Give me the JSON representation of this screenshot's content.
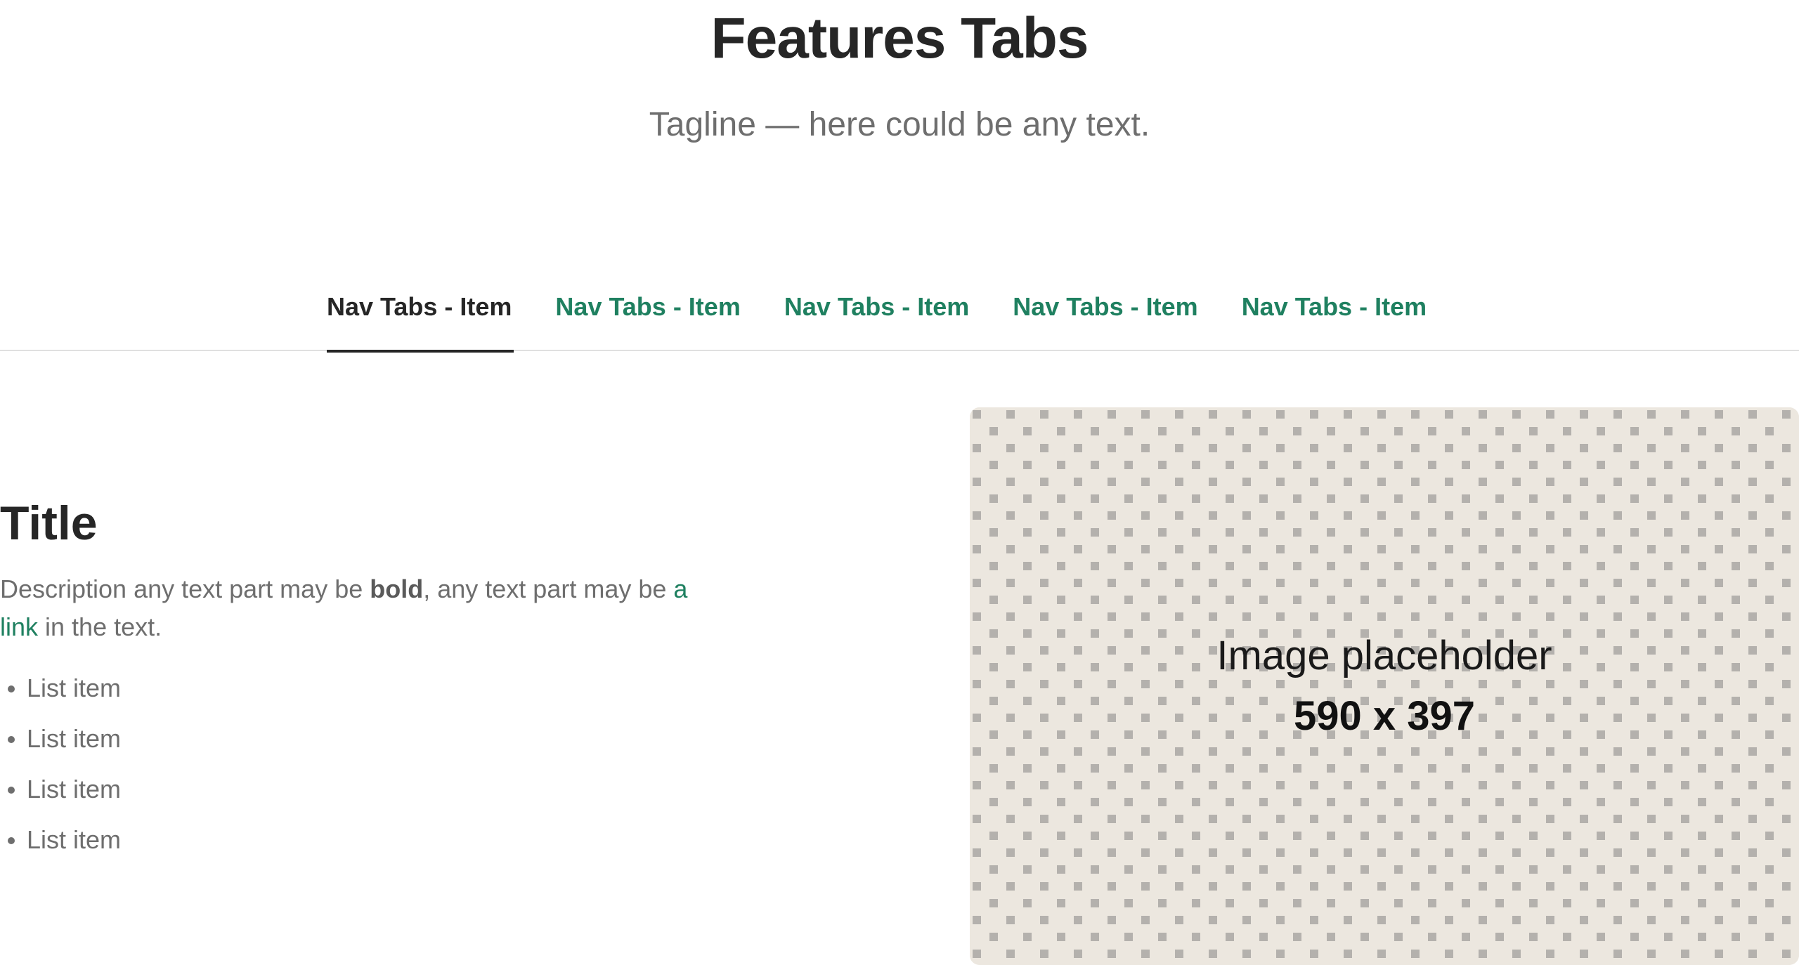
{
  "header": {
    "title": "Features Tabs",
    "tagline": "Tagline — here could be any text."
  },
  "tabs": [
    {
      "label": "Nav Tabs - Item",
      "active": true
    },
    {
      "label": "Nav Tabs - Item",
      "active": false
    },
    {
      "label": "Nav Tabs - Item",
      "active": false
    },
    {
      "label": "Nav Tabs - Item",
      "active": false
    },
    {
      "label": "Nav Tabs - Item",
      "active": false
    }
  ],
  "content": {
    "title": "Title",
    "description": {
      "before_bold": "Description any text part may be ",
      "bold": "bold",
      "after_bold": ", any text part may be ",
      "link": "a link",
      "after_link": " in the text."
    },
    "list_items": [
      "List item",
      "List item",
      "List item",
      "List item"
    ]
  },
  "image_placeholder": {
    "label": "Image placeholder",
    "size": "590 x 397"
  },
  "colors": {
    "accent": "#1f8060",
    "text": "#262626",
    "muted": "#6e6e6e",
    "placeholder_bg": "#ece7df",
    "placeholder_dot": "#b4b1ad"
  }
}
